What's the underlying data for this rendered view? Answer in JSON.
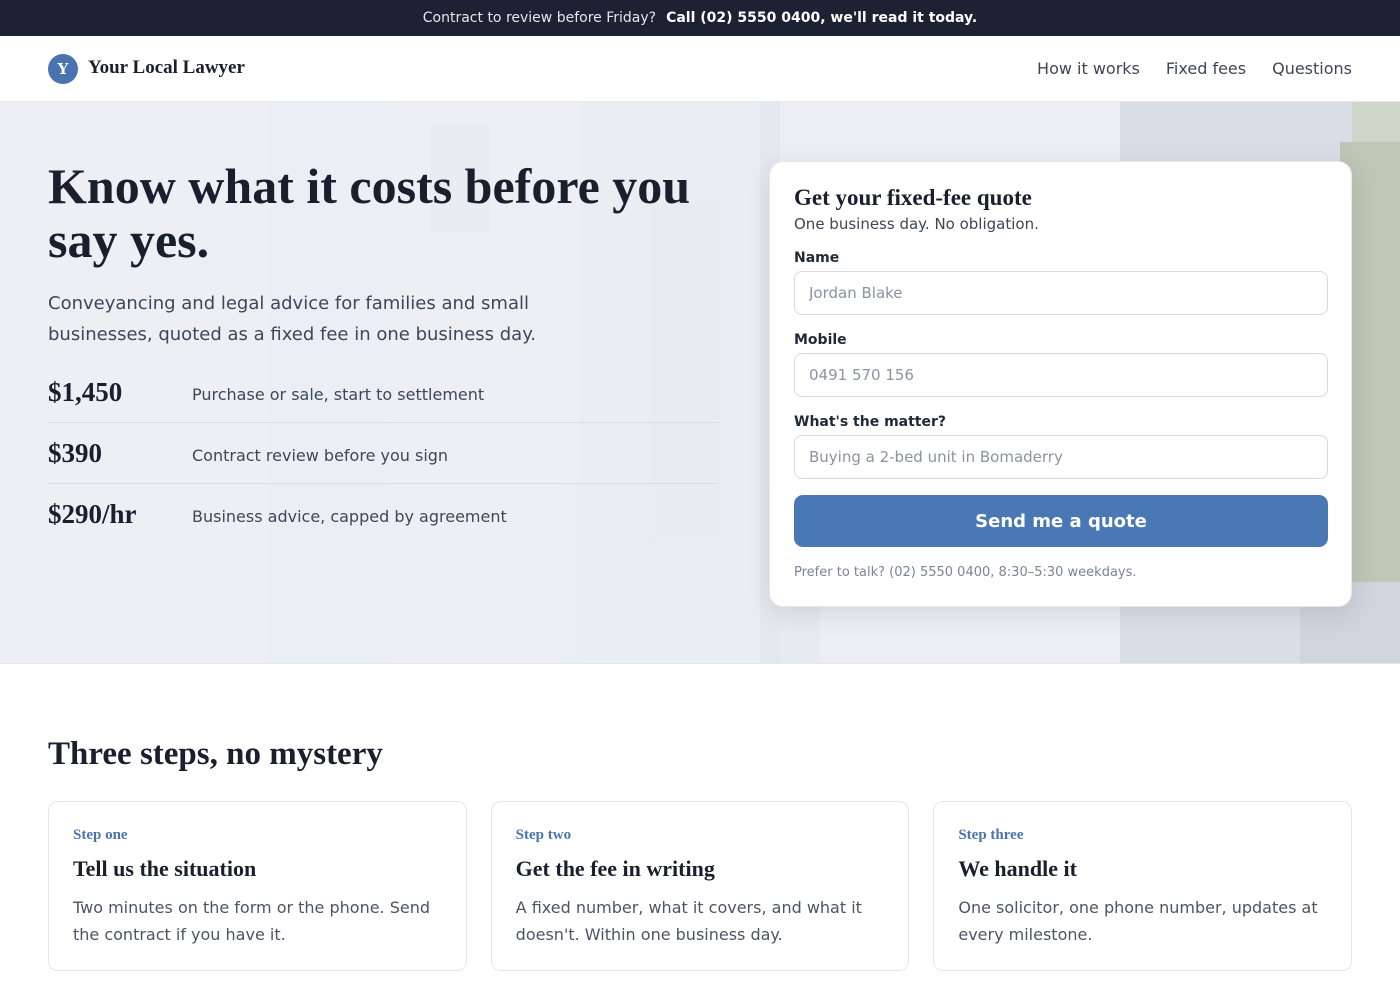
{
  "topbar": {
    "lead": "Contract to review before Friday?",
    "call": "Call (02) 5550 0400, we'll read it today."
  },
  "header": {
    "logo_letter": "Y",
    "brand": "Your Local Lawyer",
    "nav": [
      "How it works",
      "Fixed fees",
      "Questions"
    ]
  },
  "hero": {
    "title": "Know what it costs before you say yes.",
    "subtitle": "Conveyancing and legal advice for families and small businesses, quoted as a fixed fee in one business day.",
    "fees": [
      {
        "price": "$1,450",
        "desc": "Purchase or sale, start to settlement"
      },
      {
        "price": "$390",
        "desc": "Contract review before you sign"
      },
      {
        "price": "$290/hr",
        "desc": "Business advice, capped by agreement"
      }
    ]
  },
  "quote_form": {
    "title": "Get your fixed-fee quote",
    "subtitle": "One business day. No obligation.",
    "name_label": "Name",
    "name_placeholder": "Jordan Blake",
    "mobile_label": "Mobile",
    "mobile_placeholder": "0491 570 156",
    "matter_label": "What's the matter?",
    "matter_placeholder": "Buying a 2-bed unit in Bomaderry",
    "submit_label": "Send me a quote",
    "note": "Prefer to talk? (02) 5550 0400, 8:30–5:30 weekdays."
  },
  "steps": {
    "title": "Three steps, no mystery",
    "items": [
      {
        "kicker": "Step one",
        "title": "Tell us the situation",
        "text": "Two minutes on the form or the phone. Send the contract if you have it."
      },
      {
        "kicker": "Step two",
        "title": "Get the fee in writing",
        "text": "A fixed number, what it covers, and what it doesn't. Within one business day."
      },
      {
        "kicker": "Step three",
        "title": "We handle it",
        "text": "One solicitor, one phone number, updates at every milestone."
      }
    ]
  },
  "colors": {
    "topbar_bg": "#1c2133",
    "accent": "#4a78b4",
    "heading": "#1a1f2e"
  }
}
